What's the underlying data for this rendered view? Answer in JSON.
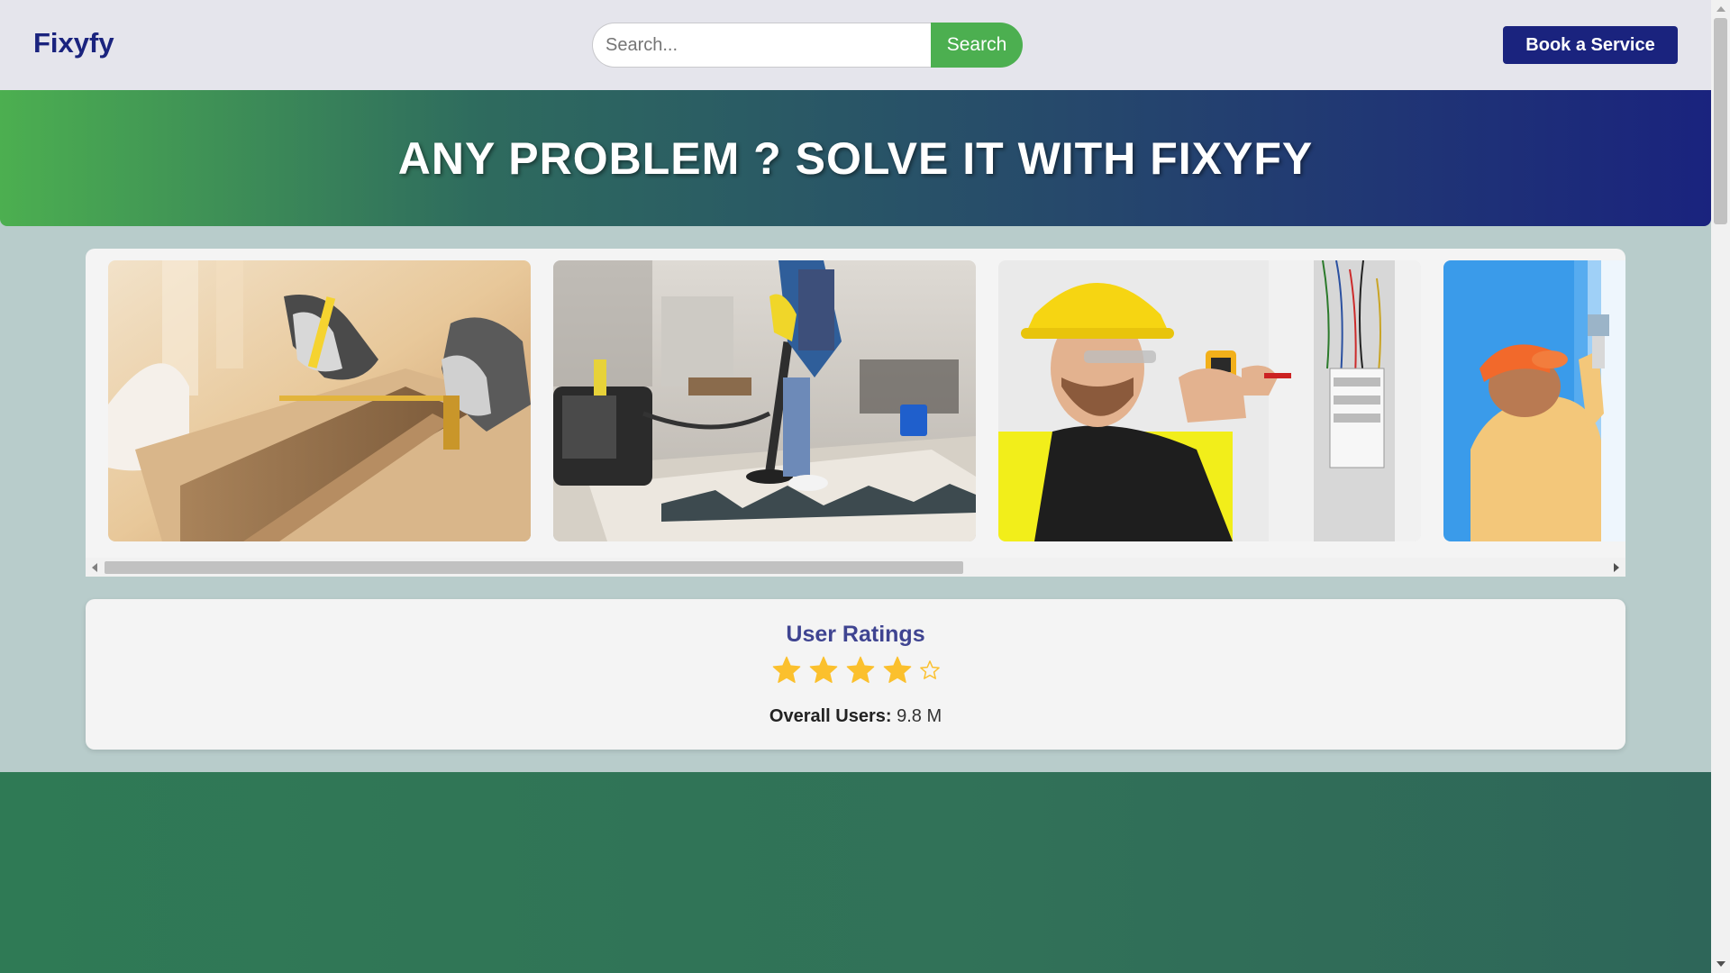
{
  "header": {
    "logo": "Fixyfy",
    "search_placeholder": "Search...",
    "search_button": "Search",
    "book_button": "Book a Service"
  },
  "hero": {
    "title": "ANY PROBLEM ? SOLVE IT WITH FIXYFY"
  },
  "gallery": {
    "images": [
      {
        "subject": "carpentry"
      },
      {
        "subject": "home cleaning"
      },
      {
        "subject": "electrician"
      },
      {
        "subject": "painting"
      }
    ],
    "scroll_position": 0
  },
  "ratings": {
    "title": "User Ratings",
    "stars_filled": 4,
    "stars_total": 5,
    "users_label": "Overall Users:",
    "users_value": " 9.8 M",
    "star_color": "#fbc02d"
  },
  "colors": {
    "brand_navy": "#1a237e",
    "brand_green": "#4caf50",
    "page_background": "#b8cccb"
  }
}
